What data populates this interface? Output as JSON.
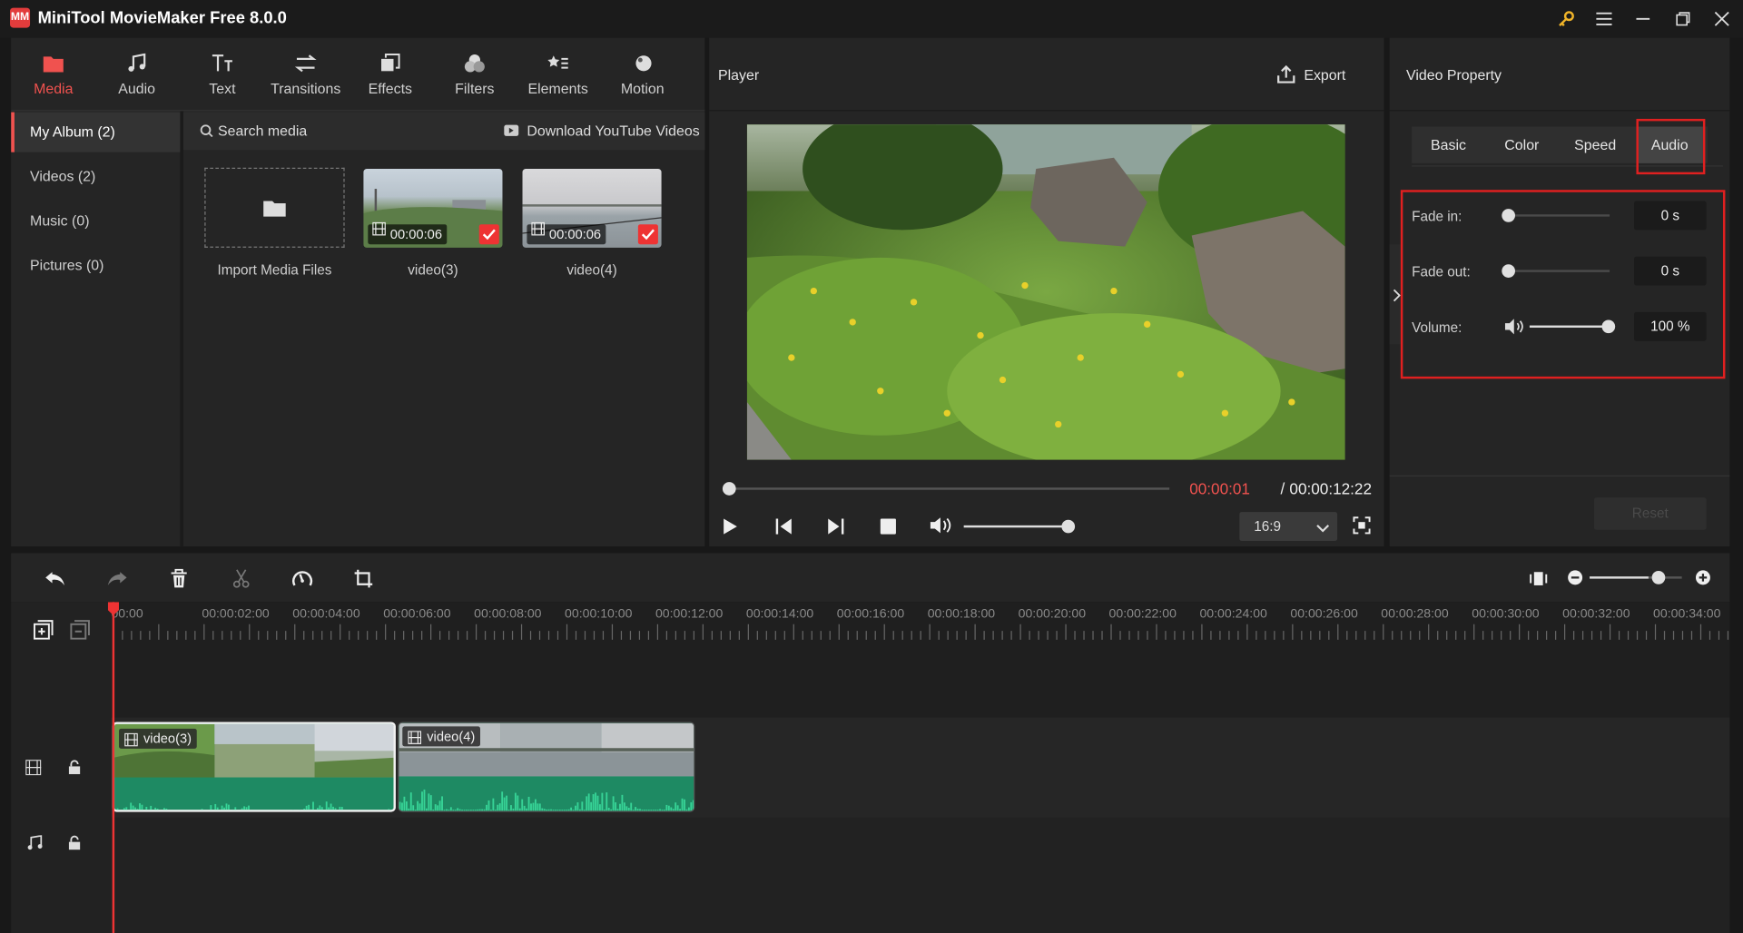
{
  "app": {
    "title": "MiniTool MovieMaker Free 8.0.0",
    "logo_text": "MM"
  },
  "toolbar": {
    "tabs": [
      {
        "label": "Media",
        "icon": "folder-icon",
        "active": true
      },
      {
        "label": "Audio",
        "icon": "music-note-icon",
        "active": false
      },
      {
        "label": "Text",
        "icon": "text-icon",
        "active": false
      },
      {
        "label": "Transitions",
        "icon": "arrows-swap-icon",
        "active": false
      },
      {
        "label": "Effects",
        "icon": "effects-icon",
        "active": false
      },
      {
        "label": "Filters",
        "icon": "filters-icon",
        "active": false
      },
      {
        "label": "Elements",
        "icon": "elements-icon",
        "active": false
      },
      {
        "label": "Motion",
        "icon": "motion-icon",
        "active": false
      }
    ]
  },
  "albums": [
    {
      "label": "My Album (2)",
      "active": true
    },
    {
      "label": "Videos (2)",
      "active": false
    },
    {
      "label": "Music (0)",
      "active": false
    },
    {
      "label": "Pictures (0)",
      "active": false
    }
  ],
  "media": {
    "search_placeholder": "Search media",
    "download_label": "Download YouTube Videos",
    "import_label": "Import Media Files",
    "items": [
      {
        "name": "video(3)",
        "duration": "00:00:06",
        "selected": true
      },
      {
        "name": "video(4)",
        "duration": "00:00:06",
        "selected": true
      }
    ]
  },
  "player": {
    "title": "Player",
    "export_label": "Export",
    "current_time": "00:00:01",
    "separator": " / ",
    "total_time": "00:00:12:22",
    "progress": 0.01,
    "volume": 0.98,
    "aspect_ratio": "16:9"
  },
  "property": {
    "title": "Video Property",
    "tabs": [
      {
        "label": "Basic",
        "active": false
      },
      {
        "label": "Color",
        "active": false
      },
      {
        "label": "Speed",
        "active": false
      },
      {
        "label": "Audio",
        "active": true
      }
    ],
    "fade_in": {
      "label": "Fade in:",
      "value": "0 s",
      "level": 0
    },
    "fade_out": {
      "label": "Fade out:",
      "value": "0 s",
      "level": 0
    },
    "volume": {
      "label": "Volume:",
      "value": "100 %",
      "level": 1.0
    },
    "reset_label": "Reset"
  },
  "timeline": {
    "ruler": [
      "00:00",
      "00:00:02:00",
      "00:00:04:00",
      "00:00:06:00",
      "00:00:08:00",
      "00:00:10:00",
      "00:00:12:00",
      "00:00:14:00",
      "00:00:16:00",
      "00:00:18:00",
      "00:00:20:00",
      "00:00:22:00",
      "00:00:24:00",
      "00:00:26:00",
      "00:00:28:00",
      "00:00:30:00",
      "00:00:32:00",
      "00:00:34:00"
    ],
    "zoom_level": 0.75,
    "clips": [
      {
        "name": "video(3)",
        "selected": true
      },
      {
        "name": "video(4)",
        "selected": false
      }
    ]
  },
  "colors": {
    "accent": "#f0524f",
    "highlight_box": "#e02020",
    "waveform": "#1e8a63",
    "waveform_peak": "#2fcf8f"
  }
}
